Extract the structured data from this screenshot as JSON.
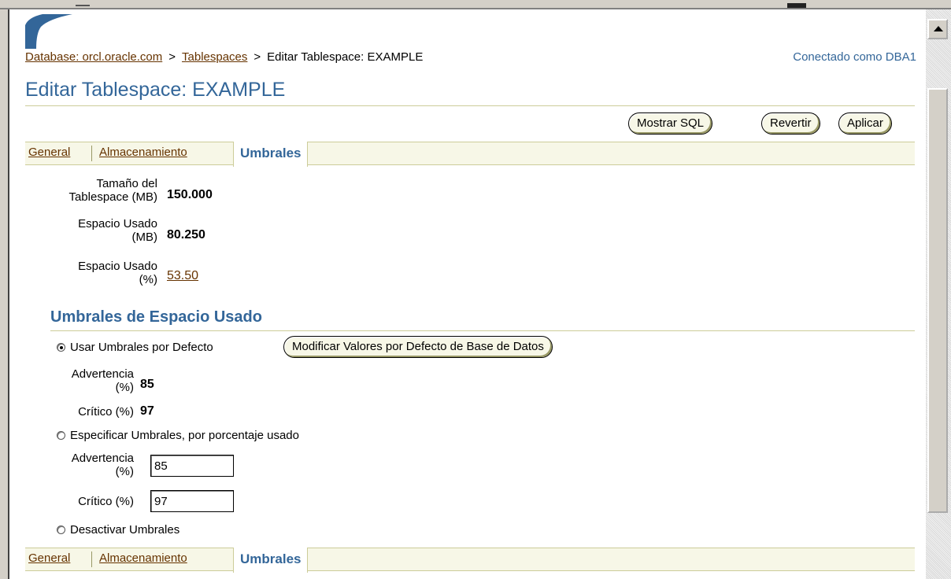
{
  "breadcrumb": {
    "database_link": "Database: orcl.oracle.com",
    "tablespaces_link": "Tablespaces",
    "separator": ">",
    "current": "Editar Tablespace: EXAMPLE"
  },
  "connected_as": "Conectado como DBA1",
  "page_title": "Editar Tablespace: EXAMPLE",
  "toolbar": {
    "show_sql_label": "Mostrar SQL",
    "revert_label": "Revertir",
    "apply_label": "Aplicar"
  },
  "tabs": [
    {
      "label": "General",
      "active": false
    },
    {
      "label": "Almacenamiento",
      "active": false
    },
    {
      "label": "Umbrales",
      "active": true
    }
  ],
  "summary": {
    "size_label_1": "Tamaño del",
    "size_label_2": "Tablespace (MB)",
    "size_value": "150.000",
    "used_label_1": "Espacio Usado",
    "used_label_2": "(MB)",
    "used_value": "80.250",
    "pct_label_1": "Espacio Usado",
    "pct_label_2": "(%)",
    "pct_value": "53.50"
  },
  "thresholds": {
    "section_title": "Umbrales de Espacio Usado",
    "use_default_label": "Usar Umbrales por Defecto",
    "modify_defaults_button": "Modificar Valores por Defecto de Base de Datos",
    "warning_label_1": "Advertencia",
    "warning_label_2": "(%)",
    "default_warning": "85",
    "critical_label": "Crítico (%)",
    "default_critical": "97",
    "specify_label": "Especificar Umbrales, por porcentaje usado",
    "warning_input_value": "85",
    "critical_input_value": "97",
    "disable_label": "Desactivar Umbrales",
    "selected_option": "use_default"
  },
  "colors": {
    "brand_blue": "#336699",
    "link_brown": "#663300",
    "tab_bg": "#f7f7e7",
    "rule": "#cccc99"
  }
}
